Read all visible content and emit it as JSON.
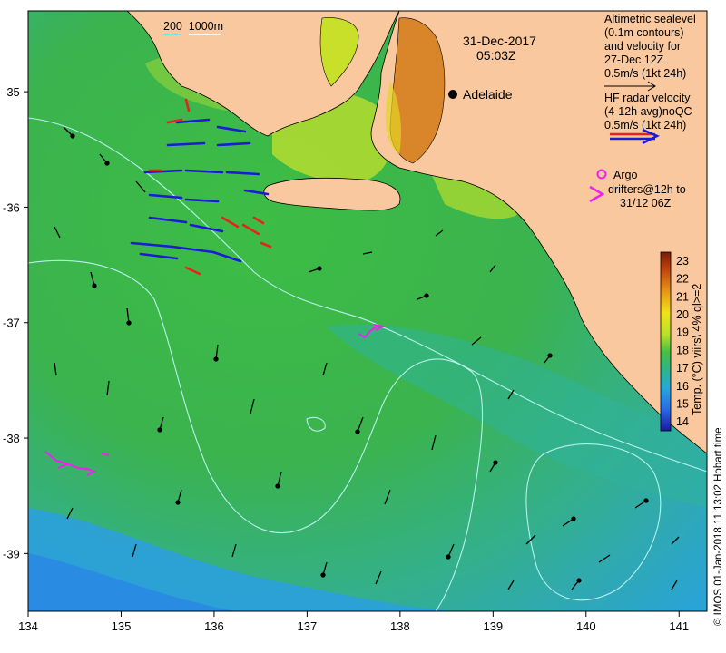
{
  "map": {
    "date": "31-Dec-2017",
    "time": "05:03Z",
    "city_label": "Adelaide",
    "depth_contours_label": "200  1000m",
    "x_ticks": [
      "134",
      "135",
      "136",
      "137",
      "138",
      "139",
      "140",
      "141"
    ],
    "y_ticks": [
      "-35",
      "-36",
      "-37",
      "-38",
      "-39"
    ],
    "x_range": [
      134,
      141.3
    ],
    "y_range": [
      -39.5,
      -34.3
    ]
  },
  "legend": {
    "altimetric_lines": [
      "Altimetric sealevel",
      "(0.1m contours)",
      "and velocity for",
      "27-Dec 12Z",
      "0.5m/s (1kt 24h)"
    ],
    "hf_radar_lines": [
      "HF radar velocity",
      "(4-12h avg)noQC",
      "0.5m/s (1kt 24h)"
    ],
    "argo_label": "Argo",
    "drifter_lines": [
      "drifters@12h to",
      "31/12 06Z"
    ]
  },
  "colorbar": {
    "ticks": [
      "23",
      "22",
      "21",
      "20",
      "19",
      "18",
      "17",
      "16",
      "15",
      "14"
    ],
    "label": "Temp. (°C) viirs\\ 4% ql>=2",
    "range": [
      13.5,
      23.5
    ]
  },
  "credit": "© IMOS 01-Jan-2018 11:13:02 Hobart time",
  "colors": {
    "land": "#f9c89e",
    "sea_green": "#3db84a",
    "sea_blue": "#28a8e0",
    "hf_red": "#e8221c",
    "hf_blue": "#1a1ad8",
    "argo_magenta": "#ee22ee"
  }
}
